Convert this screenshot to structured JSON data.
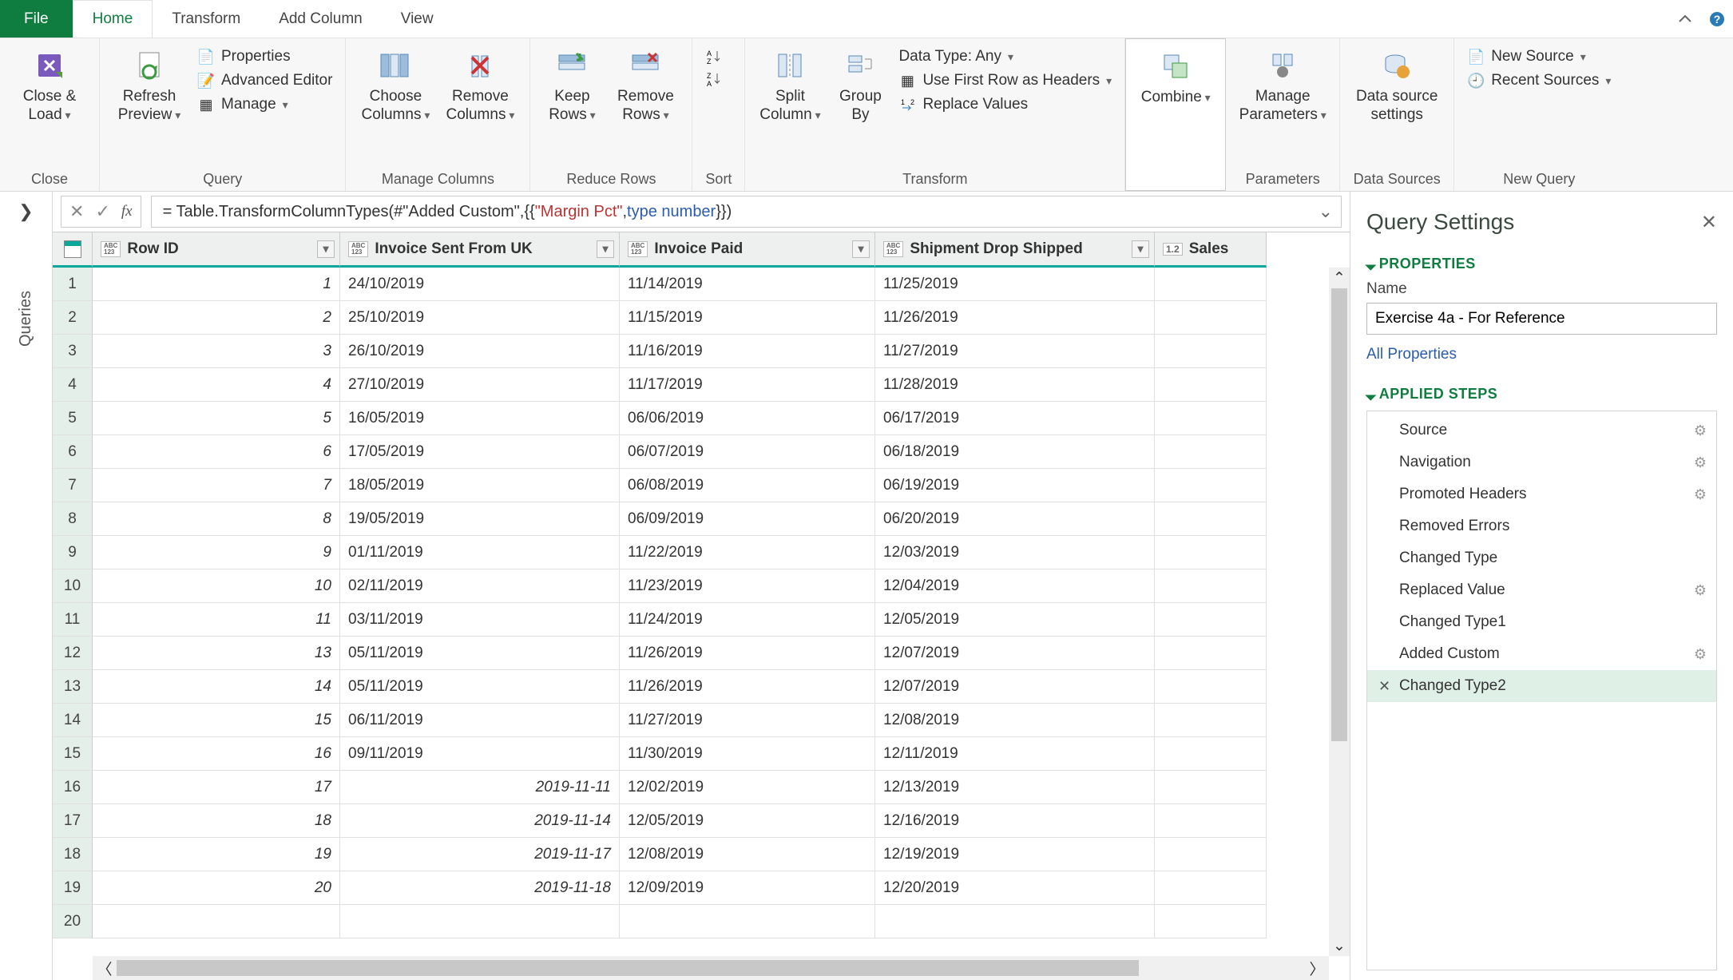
{
  "tabs": {
    "file": "File",
    "home": "Home",
    "transform": "Transform",
    "addcol": "Add Column",
    "view": "View"
  },
  "ribbon": {
    "close": {
      "closeLoad": "Close &\nLoad",
      "group": "Close"
    },
    "query": {
      "refresh": "Refresh\nPreview",
      "properties": "Properties",
      "advEditor": "Advanced Editor",
      "manage": "Manage",
      "group": "Query"
    },
    "manageCols": {
      "choose": "Choose\nColumns",
      "remove": "Remove\nColumns",
      "group": "Manage Columns"
    },
    "reduce": {
      "keep": "Keep\nRows",
      "remove": "Remove\nRows",
      "group": "Reduce Rows"
    },
    "sort": {
      "group": "Sort"
    },
    "transform": {
      "split": "Split\nColumn",
      "groupBy": "Group\nBy",
      "dataType": "Data Type: Any",
      "firstRow": "Use First Row as Headers",
      "replace": "Replace Values",
      "group": "Transform"
    },
    "combine": {
      "combine": "Combine",
      "group": ""
    },
    "params": {
      "manage": "Manage\nParameters",
      "group": "Parameters"
    },
    "dataSources": {
      "settings": "Data source\nsettings",
      "group": "Data Sources"
    },
    "newQuery": {
      "new": "New Source",
      "recent": "Recent Sources",
      "group": "New Query"
    }
  },
  "queriesRail": "Queries",
  "formula": {
    "pre": "= Table.TransformColumnTypes(#\"Added Custom\",{{",
    "str": "\"Margin Pct\"",
    "mid": ", ",
    "kw": "type number",
    "post": "}})"
  },
  "columns": [
    {
      "type": "ABC123",
      "name": "Row ID"
    },
    {
      "type": "ABC123",
      "name": "Invoice Sent From UK"
    },
    {
      "type": "ABC123",
      "name": "Invoice Paid"
    },
    {
      "type": "ABC123",
      "name": "Shipment Drop Shipped"
    },
    {
      "type": "1.2",
      "name": "Sales"
    }
  ],
  "rows": [
    {
      "n": 1,
      "id": "1",
      "c1": "24/10/2019",
      "c2": "11/14/2019",
      "c3": "11/25/2019"
    },
    {
      "n": 2,
      "id": "2",
      "c1": "25/10/2019",
      "c2": "11/15/2019",
      "c3": "11/26/2019"
    },
    {
      "n": 3,
      "id": "3",
      "c1": "26/10/2019",
      "c2": "11/16/2019",
      "c3": "11/27/2019"
    },
    {
      "n": 4,
      "id": "4",
      "c1": "27/10/2019",
      "c2": "11/17/2019",
      "c3": "11/28/2019"
    },
    {
      "n": 5,
      "id": "5",
      "c1": "16/05/2019",
      "c2": "06/06/2019",
      "c3": "06/17/2019"
    },
    {
      "n": 6,
      "id": "6",
      "c1": "17/05/2019",
      "c2": "06/07/2019",
      "c3": "06/18/2019"
    },
    {
      "n": 7,
      "id": "7",
      "c1": "18/05/2019",
      "c2": "06/08/2019",
      "c3": "06/19/2019"
    },
    {
      "n": 8,
      "id": "8",
      "c1": "19/05/2019",
      "c2": "06/09/2019",
      "c3": "06/20/2019"
    },
    {
      "n": 9,
      "id": "9",
      "c1": "01/11/2019",
      "c2": "11/22/2019",
      "c3": "12/03/2019"
    },
    {
      "n": 10,
      "id": "10",
      "c1": "02/11/2019",
      "c2": "11/23/2019",
      "c3": "12/04/2019"
    },
    {
      "n": 11,
      "id": "11",
      "c1": "03/11/2019",
      "c2": "11/24/2019",
      "c3": "12/05/2019"
    },
    {
      "n": 12,
      "id": "13",
      "c1": "05/11/2019",
      "c2": "11/26/2019",
      "c3": "12/07/2019"
    },
    {
      "n": 13,
      "id": "14",
      "c1": "05/11/2019",
      "c2": "11/26/2019",
      "c3": "12/07/2019"
    },
    {
      "n": 14,
      "id": "15",
      "c1": "06/11/2019",
      "c2": "11/27/2019",
      "c3": "12/08/2019"
    },
    {
      "n": 15,
      "id": "16",
      "c1": "09/11/2019",
      "c2": "11/30/2019",
      "c3": "12/11/2019"
    },
    {
      "n": 16,
      "id": "17",
      "c1r": "2019-11-11",
      "c2": "12/02/2019",
      "c3": "12/13/2019"
    },
    {
      "n": 17,
      "id": "18",
      "c1r": "2019-11-14",
      "c2": "12/05/2019",
      "c3": "12/16/2019"
    },
    {
      "n": 18,
      "id": "19",
      "c1r": "2019-11-17",
      "c2": "12/08/2019",
      "c3": "12/19/2019"
    },
    {
      "n": 19,
      "id": "20",
      "c1r": "2019-11-18",
      "c2": "12/09/2019",
      "c3": "12/20/2019"
    },
    {
      "n": 20,
      "id": "",
      "c1": "",
      "c2": "",
      "c3": ""
    }
  ],
  "settings": {
    "title": "Query Settings",
    "propsHeader": "PROPERTIES",
    "nameLabel": "Name",
    "nameValue": "Exercise 4a - For Reference",
    "allProps": "All Properties",
    "stepsHeader": "APPLIED STEPS",
    "steps": [
      {
        "name": "Source",
        "gear": true
      },
      {
        "name": "Navigation",
        "gear": true
      },
      {
        "name": "Promoted Headers",
        "gear": true
      },
      {
        "name": "Removed Errors",
        "gear": false
      },
      {
        "name": "Changed Type",
        "gear": false
      },
      {
        "name": "Replaced Value",
        "gear": true
      },
      {
        "name": "Changed Type1",
        "gear": false
      },
      {
        "name": "Added Custom",
        "gear": true
      },
      {
        "name": "Changed Type2",
        "gear": false,
        "selected": true
      }
    ]
  }
}
